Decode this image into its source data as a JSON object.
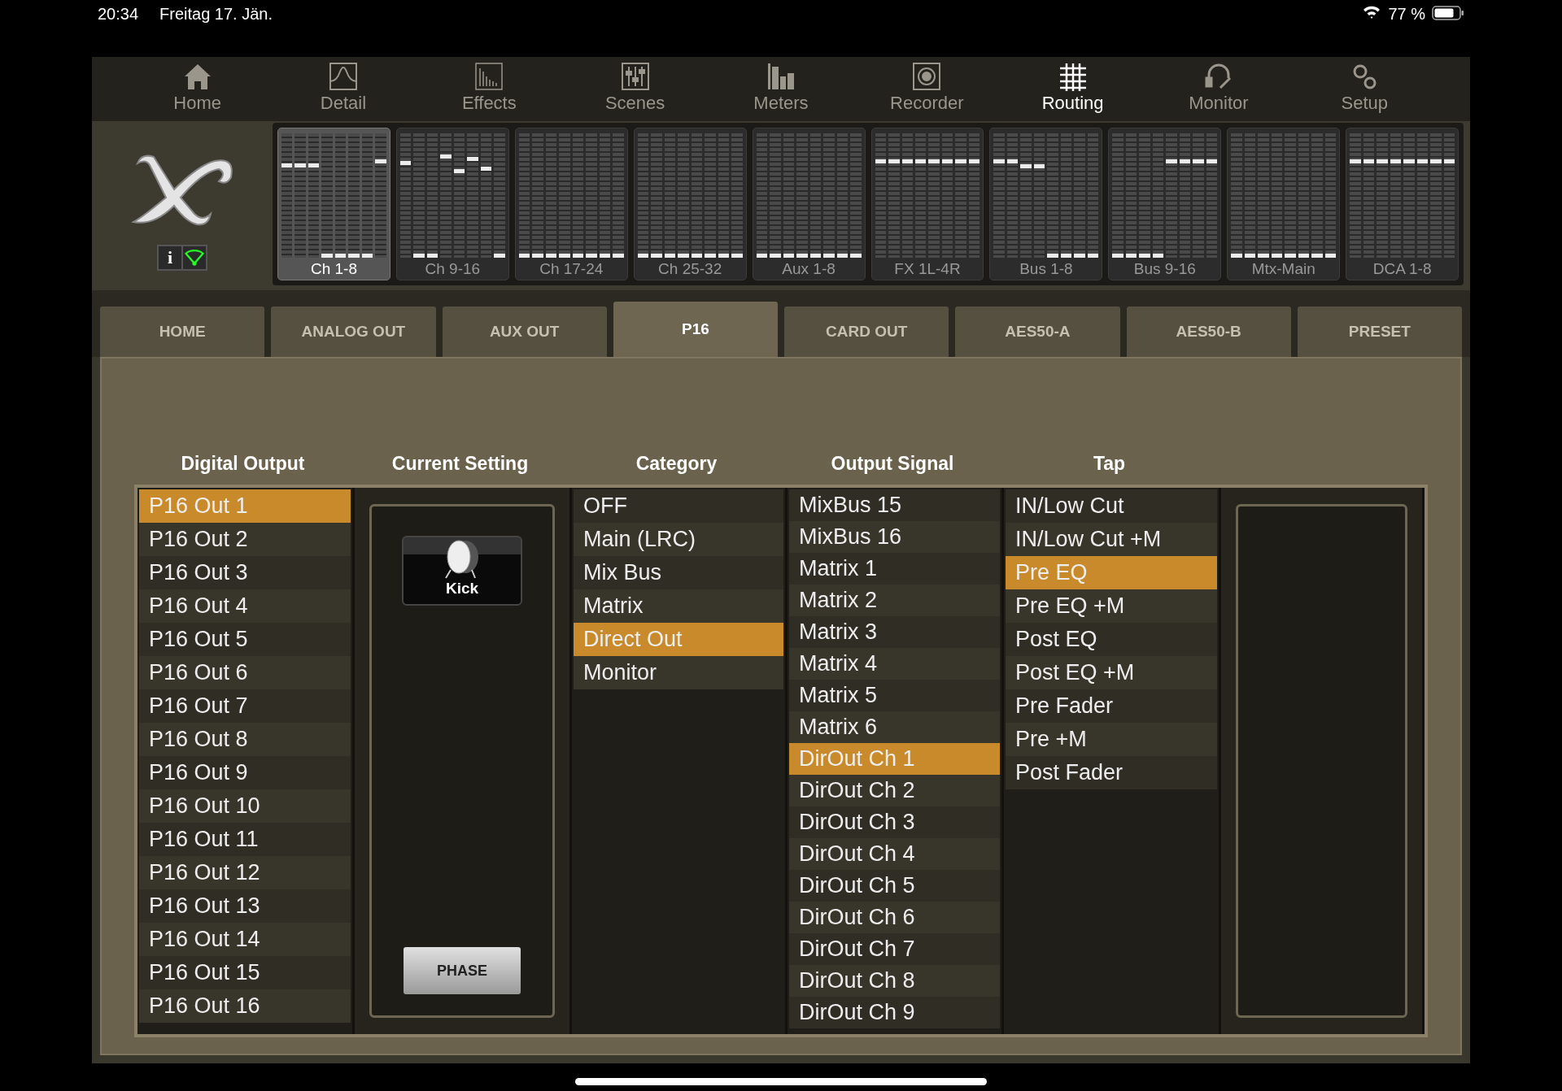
{
  "status_bar": {
    "time": "20:34",
    "date": "Freitag 17. Jän.",
    "battery": "77 %"
  },
  "nav": [
    {
      "label": "Home",
      "selected": false
    },
    {
      "label": "Detail",
      "selected": false
    },
    {
      "label": "Effects",
      "selected": false
    },
    {
      "label": "Scenes",
      "selected": false
    },
    {
      "label": "Meters",
      "selected": false
    },
    {
      "label": "Recorder",
      "selected": false
    },
    {
      "label": "Routing",
      "selected": true
    },
    {
      "label": "Monitor",
      "selected": false
    },
    {
      "label": "Setup",
      "selected": false
    }
  ],
  "banks": [
    {
      "label": "Ch 1-8",
      "selected": true,
      "faders": [
        {
          "level": 0.75
        },
        {
          "level": 0.75
        },
        {
          "level": 0.75
        },
        {
          "level": 0
        },
        {
          "level": 0
        },
        {
          "level": 0
        },
        {
          "level": 0
        },
        {
          "level": 0.78
        }
      ]
    },
    {
      "label": "Ch 9-16",
      "selected": false,
      "faders": [
        {
          "level": 0.77
        },
        {
          "level": 0
        },
        {
          "level": 0
        },
        {
          "level": 0.82
        },
        {
          "level": 0.7
        },
        {
          "level": 0.8
        },
        {
          "level": 0.72
        },
        {
          "level": 0
        }
      ]
    },
    {
      "label": "Ch 17-24",
      "selected": false,
      "faders": [
        {
          "level": 0
        },
        {
          "level": 0
        },
        {
          "level": 0
        },
        {
          "level": 0
        },
        {
          "level": 0
        },
        {
          "level": 0
        },
        {
          "level": 0
        },
        {
          "level": 0
        }
      ]
    },
    {
      "label": "Ch 25-32",
      "selected": false,
      "faders": [
        {
          "level": 0
        },
        {
          "level": 0
        },
        {
          "level": 0
        },
        {
          "level": 0
        },
        {
          "level": 0
        },
        {
          "level": 0
        },
        {
          "level": 0
        },
        {
          "level": 0
        }
      ]
    },
    {
      "label": "Aux 1-8",
      "selected": false,
      "faders": [
        {
          "level": 0
        },
        {
          "level": 0
        },
        {
          "level": 0
        },
        {
          "level": 0
        },
        {
          "level": 0
        },
        {
          "level": 0
        },
        {
          "level": 0
        },
        {
          "level": 0
        }
      ]
    },
    {
      "label": "FX 1L-4R",
      "selected": false,
      "faders": [
        {
          "level": 0.78
        },
        {
          "level": 0.78
        },
        {
          "level": 0.78
        },
        {
          "level": 0.78
        },
        {
          "level": 0.78
        },
        {
          "level": 0.78
        },
        {
          "level": 0.78
        },
        {
          "level": 0.78
        }
      ]
    },
    {
      "label": "Bus 1-8",
      "selected": false,
      "faders": [
        {
          "level": 0.78
        },
        {
          "level": 0.78
        },
        {
          "level": 0.74
        },
        {
          "level": 0.74
        },
        {
          "level": 0
        },
        {
          "level": 0
        },
        {
          "level": 0
        },
        {
          "level": 0
        }
      ]
    },
    {
      "label": "Bus 9-16",
      "selected": false,
      "faders": [
        {
          "level": 0
        },
        {
          "level": 0
        },
        {
          "level": 0
        },
        {
          "level": 0
        },
        {
          "level": 0.78
        },
        {
          "level": 0.78
        },
        {
          "level": 0.78
        },
        {
          "level": 0.78
        }
      ]
    },
    {
      "label": "Mtx-Main",
      "selected": false,
      "faders": [
        {
          "level": 0
        },
        {
          "level": 0
        },
        {
          "level": 0
        },
        {
          "level": 0
        },
        {
          "level": 0
        },
        {
          "level": 0
        },
        {
          "level": 0
        },
        {
          "level": 0
        }
      ]
    },
    {
      "label": "DCA 1-8",
      "selected": false,
      "faders": [
        {
          "level": 0.78
        },
        {
          "level": 0.78
        },
        {
          "level": 0.78
        },
        {
          "level": 0.78
        },
        {
          "level": 0.78
        },
        {
          "level": 0.78
        },
        {
          "level": 0.78
        },
        {
          "level": 0.78
        }
      ]
    }
  ],
  "tabs": [
    {
      "label": "HOME",
      "selected": false
    },
    {
      "label": "ANALOG OUT",
      "selected": false
    },
    {
      "label": "AUX OUT",
      "selected": false
    },
    {
      "label": "P16",
      "selected": true
    },
    {
      "label": "CARD OUT",
      "selected": false
    },
    {
      "label": "AES50-A",
      "selected": false
    },
    {
      "label": "AES50-B",
      "selected": false
    },
    {
      "label": "PRESET",
      "selected": false
    }
  ],
  "headers": {
    "digital_output": "Digital Output",
    "current_setting": "Current Setting",
    "category": "Category",
    "output_signal": "Output Signal",
    "tap": "Tap"
  },
  "digital_output": [
    {
      "label": "P16 Out 1",
      "selected": true
    },
    {
      "label": "P16 Out 2",
      "selected": false
    },
    {
      "label": "P16 Out 3",
      "selected": false
    },
    {
      "label": "P16 Out 4",
      "selected": false
    },
    {
      "label": "P16 Out 5",
      "selected": false
    },
    {
      "label": "P16 Out 6",
      "selected": false
    },
    {
      "label": "P16 Out 7",
      "selected": false
    },
    {
      "label": "P16 Out 8",
      "selected": false
    },
    {
      "label": "P16 Out 9",
      "selected": false
    },
    {
      "label": "P16 Out 10",
      "selected": false
    },
    {
      "label": "P16 Out 11",
      "selected": false
    },
    {
      "label": "P16 Out 12",
      "selected": false
    },
    {
      "label": "P16 Out 13",
      "selected": false
    },
    {
      "label": "P16 Out 14",
      "selected": false
    },
    {
      "label": "P16 Out 15",
      "selected": false
    },
    {
      "label": "P16 Out 16",
      "selected": false
    }
  ],
  "current_setting": {
    "channel": "Kick",
    "phase_button": "PHASE"
  },
  "info_button": "i",
  "category": [
    {
      "label": "OFF",
      "selected": false
    },
    {
      "label": "Main (LRC)",
      "selected": false
    },
    {
      "label": "Mix Bus",
      "selected": false
    },
    {
      "label": "Matrix",
      "selected": false
    },
    {
      "label": "Direct Out",
      "selected": true
    },
    {
      "label": "Monitor",
      "selected": false
    }
  ],
  "output_signal": [
    {
      "label": "MixBus 15",
      "selected": false
    },
    {
      "label": "MixBus 16",
      "selected": false
    },
    {
      "label": "Matrix 1",
      "selected": false
    },
    {
      "label": "Matrix 2",
      "selected": false
    },
    {
      "label": "Matrix 3",
      "selected": false
    },
    {
      "label": "Matrix 4",
      "selected": false
    },
    {
      "label": "Matrix 5",
      "selected": false
    },
    {
      "label": "Matrix 6",
      "selected": false
    },
    {
      "label": "DirOut Ch 1",
      "selected": true
    },
    {
      "label": "DirOut Ch 2",
      "selected": false
    },
    {
      "label": "DirOut Ch 3",
      "selected": false
    },
    {
      "label": "DirOut Ch 4",
      "selected": false
    },
    {
      "label": "DirOut Ch 5",
      "selected": false
    },
    {
      "label": "DirOut Ch 6",
      "selected": false
    },
    {
      "label": "DirOut Ch 7",
      "selected": false
    },
    {
      "label": "DirOut Ch 8",
      "selected": false
    },
    {
      "label": "DirOut Ch 9",
      "selected": false
    }
  ],
  "tap": [
    {
      "label": "IN/Low Cut",
      "selected": false
    },
    {
      "label": "IN/Low Cut +M",
      "selected": false
    },
    {
      "label": "Pre EQ",
      "selected": true
    },
    {
      "label": "Pre EQ +M",
      "selected": false
    },
    {
      "label": "Post EQ",
      "selected": false
    },
    {
      "label": "Post EQ +M",
      "selected": false
    },
    {
      "label": "Pre Fader",
      "selected": false
    },
    {
      "label": "Pre +M",
      "selected": false
    },
    {
      "label": "Post Fader",
      "selected": false
    }
  ]
}
